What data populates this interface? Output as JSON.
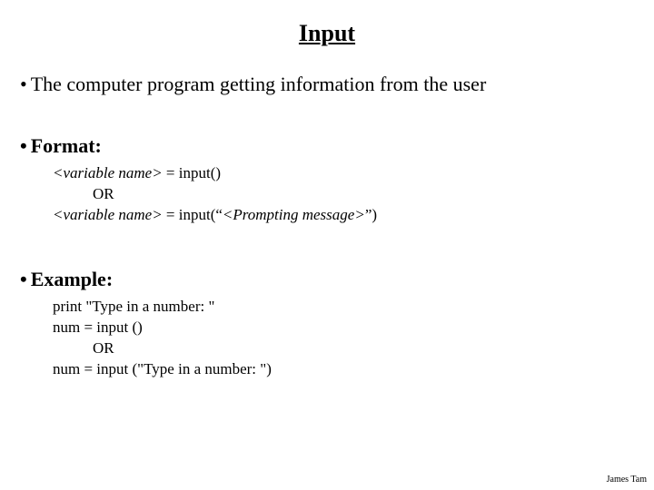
{
  "title": "Input",
  "bullets": {
    "desc": "The computer program getting information from the user",
    "format_label": "Format:",
    "example_label": "Example:"
  },
  "format": {
    "line1_pre": "<variable name>",
    "line1_post": " = input()",
    "or": "OR",
    "line2_pre": "<variable name>",
    "line2_mid": " = input(“",
    "line2_prompt": "<Prompting message>",
    "line2_post": "”)"
  },
  "example": {
    "line1": "print \"Type in a number: \"",
    "line2": "num = input ()",
    "or": "OR",
    "line3": "num = input (\"Type in a number: \")"
  },
  "footer": "James Tam"
}
